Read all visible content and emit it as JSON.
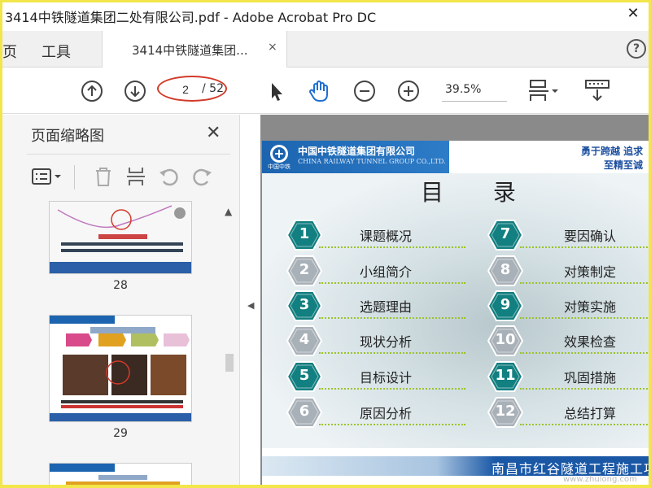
{
  "window": {
    "title": "3414中铁隧道集团二处有限公司.pdf - Adobe Acrobat Pro DC",
    "close_icon": "close-icon"
  },
  "tabs": {
    "home": "页",
    "tools": "工具",
    "doc_tab": "3414中铁隧道集团...",
    "doc_tab_close": "×",
    "help": "?"
  },
  "toolbar": {
    "current_page": "2",
    "total_pages": "/ 52",
    "zoom": "39.5%",
    "highlight_color": "#d23b2a",
    "icons": [
      "page-up-icon",
      "page-down-icon",
      "select-arrow-icon",
      "hand-tool-icon",
      "zoom-out-icon",
      "zoom-in-icon",
      "fit-page-icon",
      "scroll-mode-icon"
    ]
  },
  "sidebar": {
    "title": "页面缩略图",
    "close": "✕",
    "thumbnails": [
      {
        "label": "28"
      },
      {
        "label": "29"
      }
    ]
  },
  "slide": {
    "company_cn": "中国中铁隧道集团有限公司",
    "company_en": "CHINA RAILWAY TUNNEL GROUP CO.,LTD.",
    "logo_text": "中国中铁",
    "motto_line1": "勇于跨越  追求",
    "motto_line2": "至精至诚",
    "title": "目 录",
    "items": [
      {
        "num": "1",
        "text": "课题概况"
      },
      {
        "num": "2",
        "text": "小组简介"
      },
      {
        "num": "3",
        "text": "选题理由"
      },
      {
        "num": "4",
        "text": "现状分析"
      },
      {
        "num": "5",
        "text": "目标设计"
      },
      {
        "num": "6",
        "text": "原因分析"
      },
      {
        "num": "7",
        "text": "要因确认"
      },
      {
        "num": "8",
        "text": "对策制定"
      },
      {
        "num": "9",
        "text": "对策实施"
      },
      {
        "num": "10",
        "text": "效果检查"
      },
      {
        "num": "11",
        "text": "巩固措施"
      },
      {
        "num": "12",
        "text": "总结打算"
      }
    ],
    "footer": "南昌市红谷隧道工程施工项",
    "watermark": "www.zhulong.com",
    "colors": {
      "teal": "#127f80",
      "grey": "#a9b1b8",
      "brand_blue": "#1c64b0"
    }
  }
}
